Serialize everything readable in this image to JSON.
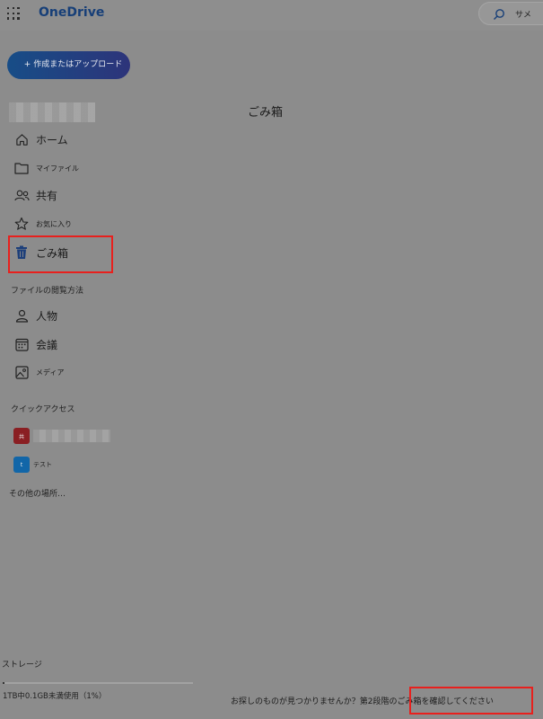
{
  "app": {
    "brand": "OneDrive"
  },
  "header": {
    "search_placeholder": "サメ"
  },
  "toolbar": {
    "create_label": "+ 作成またはアップロード"
  },
  "nav": {
    "items": [
      {
        "label": "ホーム",
        "icon": "home-icon"
      },
      {
        "label": "マイファイル",
        "icon": "folder-icon"
      },
      {
        "label": "共有",
        "icon": "people-icon"
      },
      {
        "label": "お気に入り",
        "icon": "star-icon"
      },
      {
        "label": "ごみ箱",
        "icon": "trash-icon",
        "selected": true
      }
    ]
  },
  "browse": {
    "title": "ファイルの閲覧方法",
    "items": [
      {
        "label": "人物",
        "icon": "person-icon"
      },
      {
        "label": "会議",
        "icon": "calendar-icon"
      },
      {
        "label": "メディア",
        "icon": "image-icon"
      }
    ]
  },
  "quick_access": {
    "title": "クイックアクセス",
    "items": [
      {
        "badge": "共",
        "name": "",
        "color": "#8a1f23"
      },
      {
        "badge": "t",
        "name": "テスト",
        "color": "#1266a8"
      }
    ],
    "more": "その他の場所…"
  },
  "main": {
    "title": "ごみ箱"
  },
  "storage": {
    "title": "ストレージ",
    "usage": "1TB中0.1GB未満使用（1%）",
    "percent": 1
  },
  "footer": {
    "prompt": "お探しのものが見つかりませんか？",
    "link": "第2段階のごみ箱を確認してください"
  },
  "colors": {
    "accent": "#173f78",
    "highlight": "#e8201d",
    "trash_icon": "#1d3f7a"
  }
}
